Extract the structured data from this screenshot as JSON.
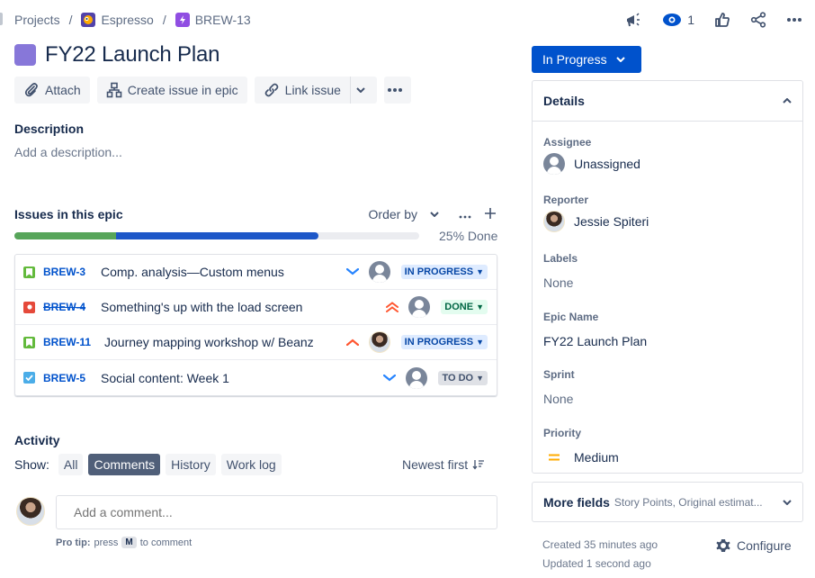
{
  "breadcrumb": {
    "items": [
      {
        "label": "Projects",
        "icon": null
      },
      {
        "label": "Espresso",
        "icon": "project-avatar-icon"
      },
      {
        "label": "BREW-13",
        "icon": "epic-icon"
      }
    ],
    "separator": "/"
  },
  "top_actions": {
    "feedback_icon": "megaphone-icon",
    "watch_icon": "eye-icon",
    "watch_count": "1",
    "vote_icon": "thumbs-up-icon",
    "share_icon": "share-icon",
    "more_icon": "more-horizontal-icon"
  },
  "issue": {
    "title": "FY22 Launch Plan",
    "type_color": "#8777d9"
  },
  "toolbar": {
    "attach_label": "Attach",
    "create_in_epic_label": "Create issue in epic",
    "link_issue_label": "Link issue"
  },
  "description": {
    "heading": "Description",
    "placeholder": "Add a description..."
  },
  "epic_issues": {
    "heading": "Issues in this epic",
    "order_by_label": "Order by",
    "progress": {
      "done_percent": 25,
      "in_progress_percent": 50,
      "todo_percent": 25,
      "label": "25% Done",
      "colors": {
        "done": "#57a55a",
        "in_progress": "#1d57c8",
        "todo": "#ebecf0"
      }
    },
    "items": [
      {
        "key": "BREW-3",
        "summary": "Comp. analysis—Custom menus",
        "type": "story",
        "priority": "low",
        "assignee": "unassigned",
        "status": "IN PROGRESS",
        "status_kind": "inprogress",
        "resolved": false
      },
      {
        "key": "BREW-4",
        "summary": "Something's up with the load screen",
        "type": "bug",
        "priority": "highest",
        "assignee": "unassigned",
        "status": "DONE",
        "status_kind": "done",
        "resolved": true
      },
      {
        "key": "BREW-11",
        "summary": "Journey mapping workshop w/ Beanz",
        "type": "story",
        "priority": "high",
        "assignee": "Jessie Spiteri",
        "status": "IN PROGRESS",
        "status_kind": "inprogress",
        "resolved": false
      },
      {
        "key": "BREW-5",
        "summary": "Social content: Week 1",
        "type": "task",
        "priority": "low",
        "assignee": "unassigned",
        "status": "TO DO",
        "status_kind": "todo",
        "resolved": false
      }
    ]
  },
  "activity": {
    "heading": "Activity",
    "show_label": "Show:",
    "filters": [
      {
        "label": "All",
        "active": false
      },
      {
        "label": "Comments",
        "active": true
      },
      {
        "label": "History",
        "active": false
      },
      {
        "label": "Work log",
        "active": false
      }
    ],
    "sort_label": "Newest first",
    "comment_placeholder": "Add a comment...",
    "pro_tip_prefix": "Pro tip:",
    "pro_tip_press": "press",
    "pro_tip_key": "M",
    "pro_tip_suffix": "to comment"
  },
  "sidebar": {
    "status_label": "In Progress",
    "status_color": "#0052cc",
    "details_heading": "Details",
    "fields": [
      {
        "label": "Assignee",
        "value": "Unassigned"
      },
      {
        "label": "Reporter",
        "value": "Jessie Spiteri"
      },
      {
        "label": "Labels",
        "value": "None"
      },
      {
        "label": "Epic Name",
        "value": "FY22 Launch Plan"
      },
      {
        "label": "Sprint",
        "value": "None"
      },
      {
        "label": "Priority",
        "value": "Medium"
      }
    ],
    "more_fields_title": "More fields",
    "more_fields_sub": "Story Points, Original estimat...",
    "created": "Created 35 minutes ago",
    "updated": "Updated 1 second ago",
    "configure_label": "Configure"
  }
}
